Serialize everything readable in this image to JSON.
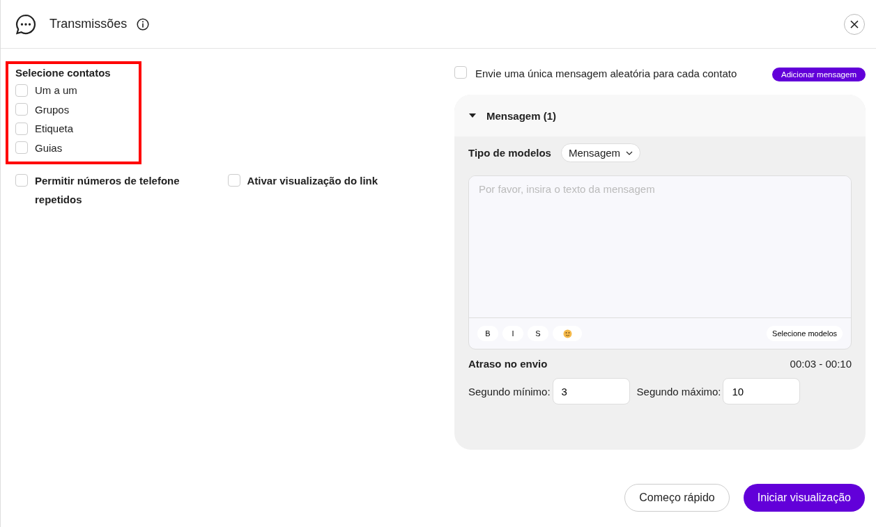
{
  "window": {
    "title": "Transmissões"
  },
  "contacts": {
    "title": "Selecione contatos",
    "highlighted": true,
    "options": [
      {
        "label": "Um a um",
        "checked": false
      },
      {
        "label": "Grupos",
        "checked": false
      },
      {
        "label": "Etiqueta",
        "checked": false
      },
      {
        "label": "Guias",
        "checked": false
      }
    ]
  },
  "settings": [
    {
      "label": "Permitir números de telefone repetidos",
      "checked": false
    },
    {
      "label": "Ativar visualização do link",
      "checked": false
    }
  ],
  "random_message": {
    "label": "Envie uma única mensagem aleatória para cada contato",
    "checked": false
  },
  "add_message_button": "Adicionar mensagem",
  "message": {
    "title": "Mensagem (1)",
    "expanded": true,
    "template_type_label": "Tipo de modelos",
    "template_type": "Mensagem",
    "placeholder": "Por favor, insira o texto da mensagem",
    "format_buttons": [
      "B",
      "I",
      "S"
    ],
    "select_templates": "Selecione modelos",
    "delay_label": "Atraso no envio",
    "delay_range": "00:03 - 00:10",
    "min_label": "Segundo mínimo:",
    "min_value": "3",
    "max_label": "Segundo máximo:",
    "max_value": "10"
  },
  "buttons": {
    "quick_start": "Começo rápido",
    "preview": "Iniciar visualização"
  }
}
